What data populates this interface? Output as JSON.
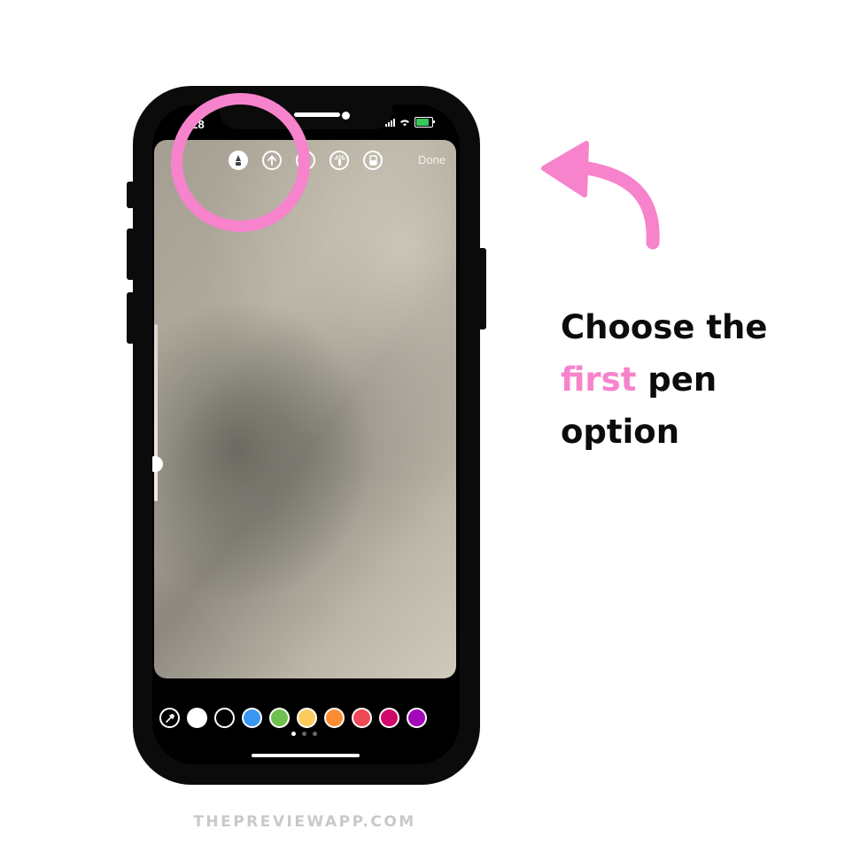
{
  "status_bar": {
    "time": ":28"
  },
  "toolbar": {
    "tools": [
      {
        "icon": "pen-icon",
        "selected": true
      },
      {
        "icon": "arrow-pen-icon",
        "selected": false
      },
      {
        "icon": "marker-icon",
        "selected": false
      },
      {
        "icon": "neon-pen-icon",
        "selected": false
      },
      {
        "icon": "eraser-icon",
        "selected": false
      }
    ],
    "done_label": "Done"
  },
  "palette": {
    "colors": [
      "#ffffff",
      "#000000",
      "#3897f0",
      "#70c050",
      "#fdcb5c",
      "#fd8d32",
      "#ed4956",
      "#d10869",
      "#a307ba"
    ],
    "page_dots": 3,
    "active_page": 0
  },
  "caption": {
    "line1": "Choose the",
    "highlight": "first",
    "rest": " pen",
    "line3": "option",
    "highlight_color": "#f783cc"
  },
  "footer": {
    "text": "THEPREVIEWAPP.COM"
  }
}
